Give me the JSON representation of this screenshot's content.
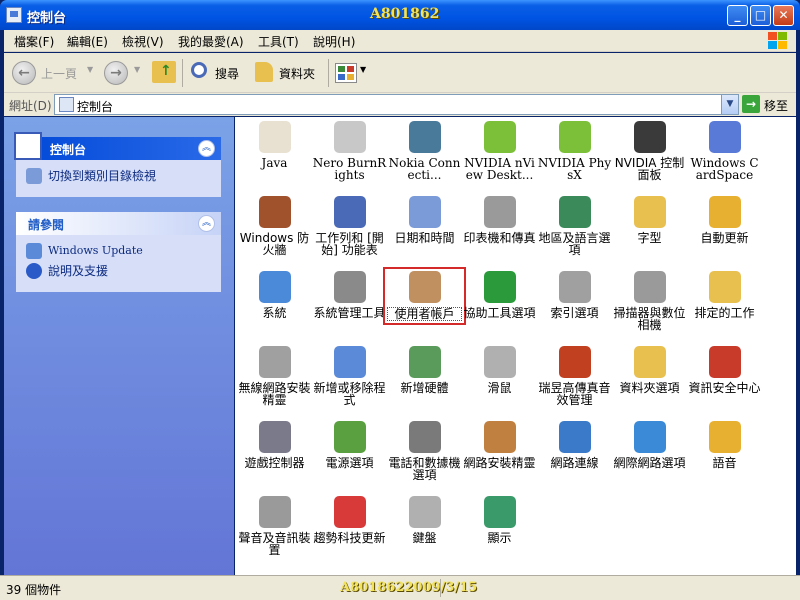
{
  "window": {
    "title": "控制台",
    "watermark_top": "A801862",
    "minimize": "_",
    "maximize": "□",
    "close": "✕"
  },
  "menu": [
    "檔案(F)",
    "編輯(E)",
    "檢視(V)",
    "我的最愛(A)",
    "工具(T)",
    "說明(H)"
  ],
  "toolbar": {
    "back": "上一頁",
    "search": "搜尋",
    "folders": "資料夾"
  },
  "address": {
    "label": "網址(D)",
    "value": "控制台",
    "go": "移至"
  },
  "left": {
    "panel1": {
      "title": "控制台",
      "task": "切換到類別目錄檢視"
    },
    "panel2": {
      "title": "請參閱",
      "tasks": [
        "Windows Update",
        "說明及支援"
      ]
    }
  },
  "items": [
    {
      "label": "Java",
      "icon": "java-icon",
      "color": "#e8e0d0"
    },
    {
      "label": "Nero BurnRights",
      "icon": "nero-disc-icon",
      "color": "#c8c8c8"
    },
    {
      "label": "Nokia Connecti...",
      "icon": "nokia-phone-icon",
      "color": "#4a7a9a"
    },
    {
      "label": "NVIDIA nView Deskt...",
      "icon": "nvidia-icon",
      "color": "#7cc03a"
    },
    {
      "label": "NVIDIA PhysX",
      "icon": "nvidia-physx-icon",
      "color": "#7cc03a"
    },
    {
      "label": "NVIDIA 控制面板",
      "icon": "nvidia-control-panel-icon",
      "color": "#3a3a3a"
    },
    {
      "label": "Windows CardSpace",
      "icon": "cardspace-icon",
      "color": "#5a7ad8"
    },
    {
      "label": "Windows 防火牆",
      "icon": "firewall-icon",
      "color": "#a0522d"
    },
    {
      "label": "工作列和 [開始] 功能表",
      "icon": "taskbar-icon",
      "color": "#4a6ab8"
    },
    {
      "label": "日期和時間",
      "icon": "calendar-clock-icon",
      "color": "#7a9ad8"
    },
    {
      "label": "印表機和傳真",
      "icon": "printer-icon",
      "color": "#9a9a9a"
    },
    {
      "label": "地區及語言選項",
      "icon": "globe-clock-icon",
      "color": "#3a8a5a"
    },
    {
      "label": "字型",
      "icon": "fonts-folder-icon",
      "color": "#e8c050"
    },
    {
      "label": "自動更新",
      "icon": "auto-update-icon",
      "color": "#e8b030"
    },
    {
      "label": "系統",
      "icon": "system-monitor-icon",
      "color": "#4a8ad8"
    },
    {
      "label": "系統管理工具",
      "icon": "admin-tools-icon",
      "color": "#8a8a8a"
    },
    {
      "label": "使用者帳戶",
      "icon": "user-accounts-icon",
      "color": "#c09060"
    },
    {
      "label": "協助工具選項",
      "icon": "accessibility-icon",
      "color": "#2a9a3a"
    },
    {
      "label": "索引選項",
      "icon": "magnifier-icon",
      "color": "#a0a0a0"
    },
    {
      "label": "掃描器與數位相機",
      "icon": "scanner-camera-icon",
      "color": "#9a9a9a"
    },
    {
      "label": "排定的工作",
      "icon": "scheduled-tasks-icon",
      "color": "#e8c050"
    },
    {
      "label": "無線網路安裝精靈",
      "icon": "wireless-icon",
      "color": "#a0a0a0"
    },
    {
      "label": "新增或移除程式",
      "icon": "add-remove-programs-icon",
      "color": "#5a8ad8"
    },
    {
      "label": "新增硬體",
      "icon": "add-hardware-icon",
      "color": "#5a9a5a"
    },
    {
      "label": "滑鼠",
      "icon": "mouse-icon",
      "color": "#b0b0b0"
    },
    {
      "label": "瑞昱高傳真音效管理",
      "icon": "realtek-speaker-icon",
      "color": "#c04020"
    },
    {
      "label": "資料夾選項",
      "icon": "folder-options-icon",
      "color": "#e8c050"
    },
    {
      "label": "資訊安全中心",
      "icon": "security-shield-icon",
      "color": "#c83a2a"
    },
    {
      "label": "遊戲控制器",
      "icon": "gamepad-icon",
      "color": "#7a7a8a"
    },
    {
      "label": "電源選項",
      "icon": "power-options-icon",
      "color": "#5aa040"
    },
    {
      "label": "電話和數據機選項",
      "icon": "phone-modem-icon",
      "color": "#7a7a7a"
    },
    {
      "label": "網路安裝精靈",
      "icon": "network-setup-icon",
      "color": "#c08040"
    },
    {
      "label": "網路連線",
      "icon": "network-connections-icon",
      "color": "#3a7ac8"
    },
    {
      "label": "網際網路選項",
      "icon": "internet-options-icon",
      "color": "#3a8ad8"
    },
    {
      "label": "語音",
      "icon": "speech-icon",
      "color": "#e8b030"
    },
    {
      "label": "聲音及音訊裝置",
      "icon": "sound-speaker-icon",
      "color": "#9a9a9a"
    },
    {
      "label": "趨勢科技更新",
      "icon": "trend-micro-icon",
      "color": "#d83a3a"
    },
    {
      "label": "鍵盤",
      "icon": "keyboard-icon",
      "color": "#b0b0b0"
    },
    {
      "label": "顯示",
      "icon": "display-icon",
      "color": "#3a9a6a"
    }
  ],
  "selected_index": 16,
  "status": {
    "count": "39 個物件",
    "watermark": "A8018622009/3/15"
  }
}
